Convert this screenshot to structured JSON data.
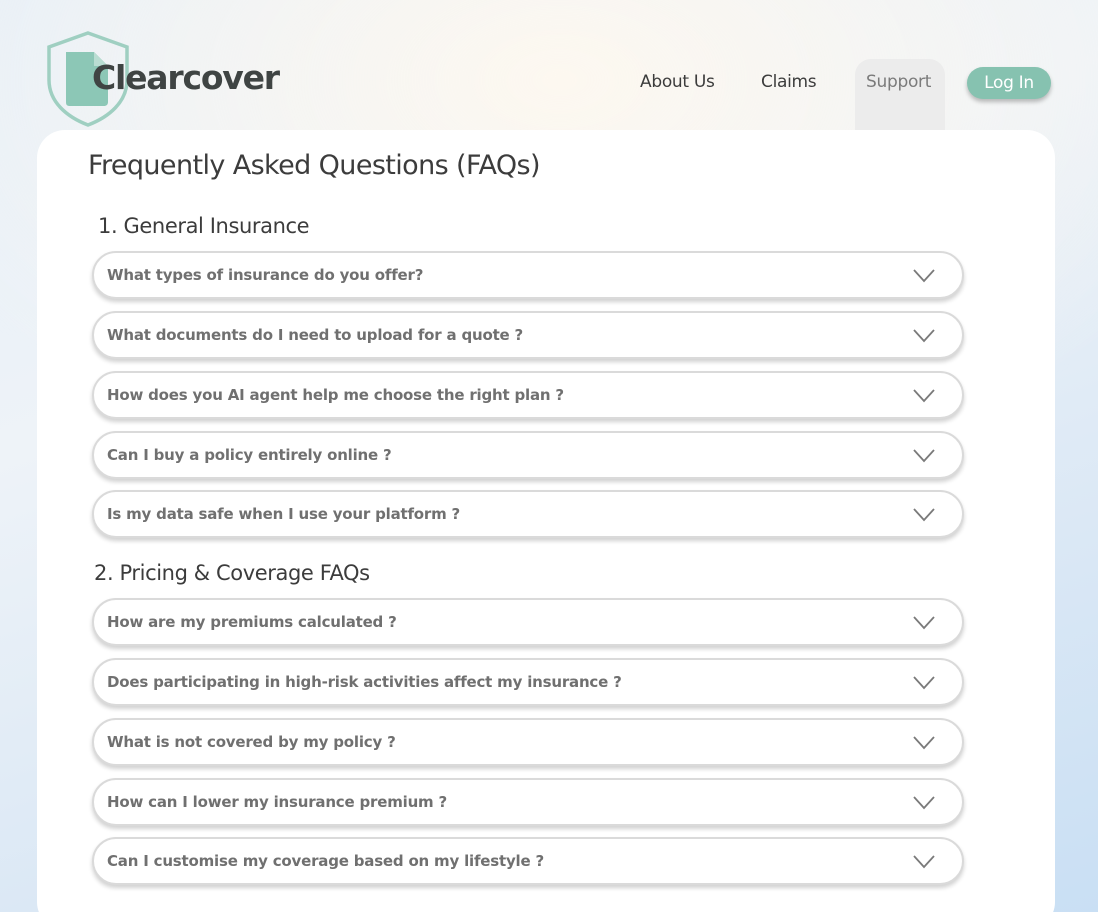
{
  "brand": {
    "name": "Clearcover"
  },
  "nav": {
    "links": [
      "About Us",
      "Claims",
      "Support"
    ],
    "login_label": "Log In"
  },
  "page": {
    "title": "Frequently Asked Questions (FAQs)"
  },
  "sections": [
    {
      "title": "1. General Insurance",
      "questions": [
        "What types of insurance do you offer?",
        "What documents do I need to upload for a quote ?",
        "How does you AI agent help me choose the right plan ?",
        "Can I buy a policy entirely online ?",
        "Is my data safe when I use your platform ?"
      ]
    },
    {
      "title": "2. Pricing & Coverage FAQs",
      "questions": [
        "How are my premiums calculated ?",
        "Does participating in high-risk activities affect my insurance ?",
        "What is not covered by my policy ?",
        "How can I lower my insurance premium ?",
        "Can I customise my coverage based on my lifestyle ?"
      ]
    }
  ],
  "icons": {
    "faq_toggle": "chevron-down-icon",
    "logo": "shield-icon"
  },
  "colors": {
    "brand_teal": "#86c2b0",
    "active_tab": "#ececec"
  }
}
